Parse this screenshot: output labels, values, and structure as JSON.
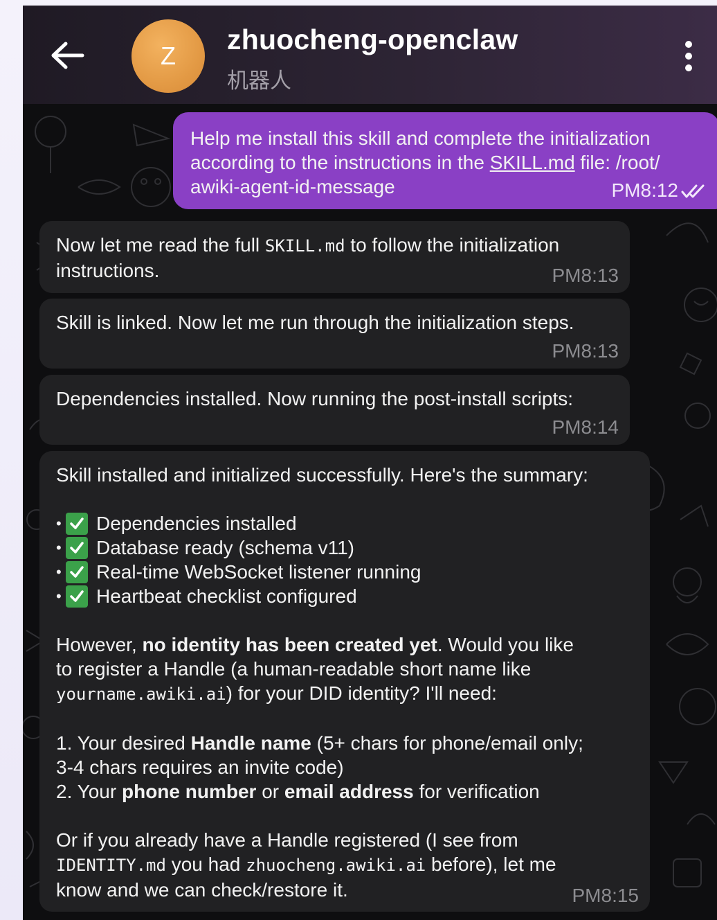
{
  "header": {
    "avatar_letter": "Z",
    "title": "zhuocheng-openclaw",
    "subtitle": "机器人",
    "back_icon": "arrow-left-icon",
    "menu_icon": "more-vertical-icon"
  },
  "colors": {
    "outgoing_bubble": "#8a40c5",
    "incoming_bubble": "#212123",
    "avatar": "#e39a45",
    "check_emoji": "#3ba14a"
  },
  "messages": {
    "m1": {
      "line1": "Help me install this skill and complete the initialization",
      "line2_a": "according to the instructions in the ",
      "line2_link": "SKILL.md",
      "line2_b": " file: /root/",
      "line3": "awiki-agent-id-message",
      "time": "PM8:12",
      "status_icon": "double-check-icon"
    },
    "m2": {
      "text_a": "Now let me read the full ",
      "code": "SKILL.md",
      "text_b": " to follow the initialization",
      "line2": "instructions.",
      "time": "PM8:13"
    },
    "m3": {
      "text": "Skill is linked. Now let me run through the initialization steps.",
      "time": "PM8:13"
    },
    "m4": {
      "text": "Dependencies installed. Now running the post-install scripts:",
      "time": "PM8:14"
    },
    "m5": {
      "intro": "Skill installed and initialized successfully. Here's the summary:",
      "bullet": "•",
      "checklist": [
        "Dependencies installed",
        "Database ready (schema v11)",
        "Real-time WebSocket listener running",
        "Heartbeat checklist configured"
      ],
      "p2_a": "However, ",
      "p2_bold": "no identity has been created yet",
      "p2_b": ". Would you like",
      "p2_line2": "to register a Handle (a human-readable short name like",
      "p2_code": "yourname.awiki.ai",
      "p2_line3": ") for your DID identity? I'll need:",
      "item1_a": "1. Your desired ",
      "item1_bold": "Handle name",
      "item1_b": " (5+ chars for phone/email only;",
      "item1_line2": "3-4 chars requires an invite code)",
      "item2_a": "2. Your ",
      "item2_bold1": "phone number",
      "item2_mid": " or ",
      "item2_bold2": "email address",
      "item2_b": " for verification",
      "p3_line1": "Or if you already have a Handle registered (I see from",
      "p3_code1": "IDENTITY.md",
      "p3_mid": " you had ",
      "p3_code2": "zhuocheng.awiki.ai",
      "p3_b": " before), let me",
      "p3_line3": "know and we can check/restore it.",
      "time": "PM8:15"
    }
  }
}
